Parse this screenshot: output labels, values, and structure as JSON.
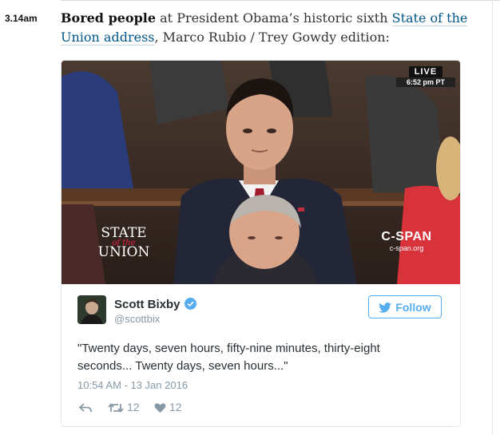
{
  "entry": {
    "time": "3.14am",
    "bold_lead": "Bored people",
    "text_1": " at President Obama’s historic sixth ",
    "link_text": "State of the Union address",
    "text_2": ", Marco Rubio / Trey Gowdy edition:"
  },
  "media": {
    "live_label": "LIVE",
    "live_time": "6:52 pm PT",
    "sotu_line1": "STATE",
    "sotu_line2": "of the",
    "sotu_line3": "UNION",
    "network_name": "C-SPAN",
    "network_url": "c-span.org"
  },
  "tweet": {
    "author_name": "Scott Bixby",
    "author_handle": "@scottbix",
    "follow_label": "Follow",
    "text": "\"Twenty days, seven hours, fifty-nine minutes, thirty-eight seconds... Twenty days, seven hours...\"",
    "timestamp": "10:54 AM - 13 Jan 2016",
    "retweets": "12",
    "likes": "12"
  },
  "colors": {
    "link": "#005689",
    "twitter_blue": "#55acee",
    "muted": "#8899a6"
  }
}
